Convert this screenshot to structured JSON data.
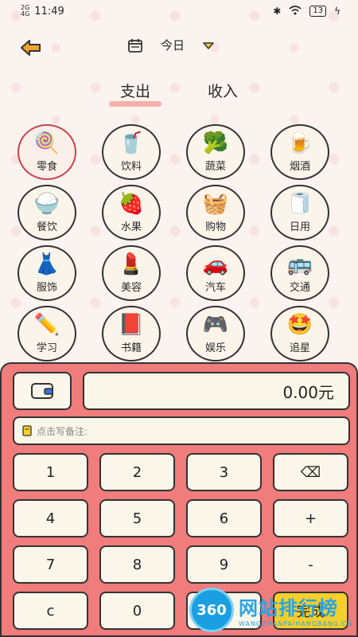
{
  "status_bar": {
    "network": "2G",
    "network2": "4G",
    "time": "11:49",
    "battery": "13"
  },
  "header": {
    "date": "今日"
  },
  "tabs": [
    {
      "label": "支出",
      "active": true
    },
    {
      "label": "收入",
      "active": false
    }
  ],
  "categories": [
    {
      "label": "零食",
      "icon": "lollipop-icon",
      "glyph": "🍭",
      "selected": true
    },
    {
      "label": "饮料",
      "icon": "drink-icon",
      "glyph": "🥤"
    },
    {
      "label": "蔬菜",
      "icon": "broccoli-icon",
      "glyph": "🥦"
    },
    {
      "label": "烟酒",
      "icon": "beer-icon",
      "glyph": "🍺"
    },
    {
      "label": "餐饮",
      "icon": "food-bowl-icon",
      "glyph": "🍚"
    },
    {
      "label": "水果",
      "icon": "strawberry-icon",
      "glyph": "🍓"
    },
    {
      "label": "购物",
      "icon": "basket-icon",
      "glyph": "🧺"
    },
    {
      "label": "日用",
      "icon": "toilet-paper-icon",
      "glyph": "🧻"
    },
    {
      "label": "服饰",
      "icon": "dress-icon",
      "glyph": "👗"
    },
    {
      "label": "美容",
      "icon": "cosmetics-icon",
      "glyph": "💄"
    },
    {
      "label": "汽车",
      "icon": "car-icon",
      "glyph": "🚗"
    },
    {
      "label": "交通",
      "icon": "bus-icon",
      "glyph": "🚌"
    },
    {
      "label": "学习",
      "icon": "pencil-icon",
      "glyph": "✏️"
    },
    {
      "label": "书籍",
      "icon": "book-icon",
      "glyph": "📕"
    },
    {
      "label": "娱乐",
      "icon": "gamepad-icon",
      "glyph": "🎮"
    },
    {
      "label": "追星",
      "icon": "star-face-icon",
      "glyph": "🤩"
    }
  ],
  "keypad": {
    "amount": "0.00元",
    "note_placeholder": "点击写备注:",
    "keys": [
      "1",
      "2",
      "3",
      "⌫",
      "4",
      "5",
      "6",
      "+",
      "7",
      "8",
      "9",
      "-",
      "c",
      "0",
      ".",
      "完成"
    ]
  },
  "watermark": {
    "badge": "360",
    "main": "网站排行榜",
    "sub": "WANGZHANPAIHANGBANG.CN"
  },
  "colors": {
    "accent": "#f07c7c",
    "done": "#f6cf2a",
    "selected": "#c9434b",
    "watermark": "#29a3e6"
  }
}
